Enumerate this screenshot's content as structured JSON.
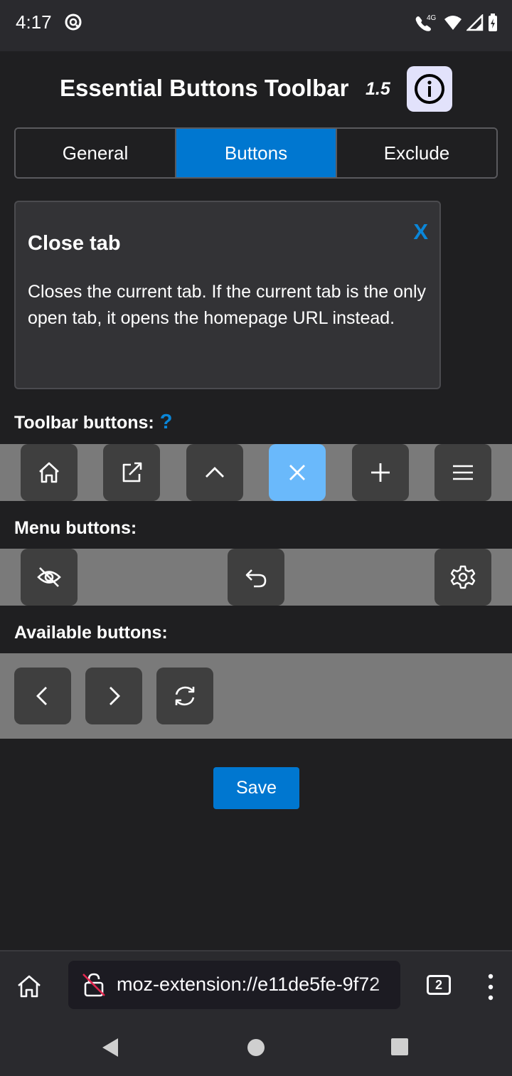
{
  "status_bar": {
    "time": "4:17",
    "network": "4G"
  },
  "header": {
    "title": "Essential Buttons Toolbar",
    "version": "1.5"
  },
  "tabs": [
    {
      "label": "General",
      "active": false
    },
    {
      "label": "Buttons",
      "active": true
    },
    {
      "label": "Exclude",
      "active": false
    }
  ],
  "description": {
    "title": "Close tab",
    "text": "Closes the current tab. If the current tab is the only open tab, it opens the homepage URL instead.",
    "close_label": "X"
  },
  "sections": {
    "toolbar_label": "Toolbar buttons:",
    "help_glyph": "?",
    "menu_label": "Menu buttons:",
    "available_label": "Available buttons:"
  },
  "toolbar_buttons": [
    {
      "icon": "home-icon"
    },
    {
      "icon": "open-external-icon"
    },
    {
      "icon": "chevron-up-icon"
    },
    {
      "icon": "close-icon",
      "selected": true
    },
    {
      "icon": "plus-icon"
    },
    {
      "icon": "menu-icon"
    }
  ],
  "menu_buttons": [
    {
      "icon": "eye-off-icon"
    },
    {
      "icon": "undo-icon"
    },
    {
      "icon": "gear-icon"
    }
  ],
  "available_buttons": [
    {
      "icon": "chevron-left-icon"
    },
    {
      "icon": "chevron-right-icon"
    },
    {
      "icon": "refresh-icon"
    }
  ],
  "save_label": "Save",
  "browser": {
    "url": "moz-extension://e11de5fe-9f72",
    "tab_count": "2"
  },
  "colors": {
    "accent": "#0077d0",
    "selected_button": "#6ab9fb",
    "background": "#1f1f21"
  }
}
